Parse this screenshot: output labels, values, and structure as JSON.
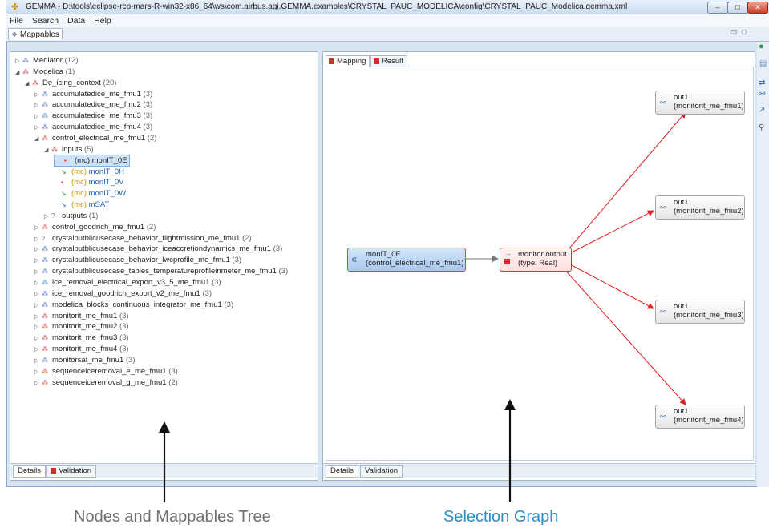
{
  "window": {
    "title": "GEMMA - D:\\tools\\eclipse-rcp-mars-R-win32-x86_64\\ws\\com.airbus.agi.GEMMA.examples\\CRYSTAL_PAUC_MODELICA\\config\\CRYSTAL_PAUC_Modelica.gemma.xml",
    "buttons": [
      "–",
      "□",
      "✕"
    ]
  },
  "menu": [
    "File",
    "Search",
    "Data",
    "Help"
  ],
  "view_tab": "Mappables",
  "tree": [
    {
      "label": "Mediator",
      "count": "(12)",
      "toggle": "▷",
      "icon": "mediator"
    },
    {
      "label": "Modelica",
      "count": "(1)",
      "toggle": "◢",
      "icon": "modelica"
    },
    {
      "label": "De_icing_context",
      "count": "(20)",
      "toggle": "◢",
      "icon": "context"
    },
    {
      "label": "accumulatedice_me_fmu1",
      "count": "(3)",
      "toggle": "▷",
      "icon": "node"
    },
    {
      "label": "accumulatedice_me_fmu2",
      "count": "(3)",
      "toggle": "▷",
      "icon": "node"
    },
    {
      "label": "accumulatedice_me_fmu3",
      "count": "(3)",
      "toggle": "▷",
      "icon": "node"
    },
    {
      "label": "accumulatedice_me_fmu4",
      "count": "(3)",
      "toggle": "▷",
      "icon": "node"
    },
    {
      "label": "control_electrical_me_fmu1",
      "count": "(2)",
      "toggle": "◢",
      "icon": "node-red"
    },
    {
      "label": "inputs",
      "count": "(5)",
      "toggle": "◢",
      "icon": "inputs"
    },
    {
      "prefix": "(mc)",
      "label": "monIT_0E",
      "count": "",
      "toggle": "",
      "icon": "input-red",
      "selected": true
    },
    {
      "prefix": "(mc)",
      "label": "monIT_0H",
      "count": "",
      "toggle": "",
      "icon": "input-green"
    },
    {
      "prefix": "(mc)",
      "label": "monIT_0V",
      "count": "",
      "toggle": "",
      "icon": "input-red"
    },
    {
      "prefix": "(mc)",
      "label": "monIT_0W",
      "count": "",
      "toggle": "",
      "icon": "input-green"
    },
    {
      "prefix": "(mc)",
      "label": "mSAT",
      "count": "",
      "toggle": "",
      "icon": "input-blue"
    },
    {
      "label": "outputs",
      "count": "(1)",
      "toggle": "▷",
      "icon": "outputs"
    },
    {
      "label": "control_goodrich_me_fmu1",
      "count": "(2)",
      "toggle": "▷",
      "icon": "node-red"
    },
    {
      "label": "crystalputblicusecase_behavior_flightmission_me_fmu1",
      "count": "(2)",
      "toggle": "▷",
      "icon": "node-q"
    },
    {
      "label": "crystalputblicusecase_behavior_iceaccretiondynamics_me_fmu1",
      "count": "(3)",
      "toggle": "▷",
      "icon": "node"
    },
    {
      "label": "crystalputblicusecase_behavior_lwcprofile_me_fmu1",
      "count": "(3)",
      "toggle": "▷",
      "icon": "node"
    },
    {
      "label": "crystalputblicusecase_tables_temperatureprofileinmeter_me_fmu1",
      "count": "(3)",
      "toggle": "▷",
      "icon": "node"
    },
    {
      "label": "ice_removal_electrical_export_v3_5_me_fmu1",
      "count": "(3)",
      "toggle": "▷",
      "icon": "node"
    },
    {
      "label": "ice_removal_goodrich_export_v2_me_fmu1",
      "count": "(3)",
      "toggle": "▷",
      "icon": "node"
    },
    {
      "label": "modelica_blocks_continuous_integrator_me_fmu1",
      "count": "(3)",
      "toggle": "▷",
      "icon": "node"
    },
    {
      "label": "monitorit_me_fmu1",
      "count": "(3)",
      "toggle": "▷",
      "icon": "node-red"
    },
    {
      "label": "monitorit_me_fmu2",
      "count": "(3)",
      "toggle": "▷",
      "icon": "node-red"
    },
    {
      "label": "monitorit_me_fmu3",
      "count": "(3)",
      "toggle": "▷",
      "icon": "node-red"
    },
    {
      "label": "monitorit_me_fmu4",
      "count": "(3)",
      "toggle": "▷",
      "icon": "node-red"
    },
    {
      "label": "monitorsat_me_fmu1",
      "count": "(3)",
      "toggle": "▷",
      "icon": "node"
    },
    {
      "label": "sequenceiceremoval_e_me_fmu1",
      "count": "(3)",
      "toggle": "▷",
      "icon": "node-red"
    },
    {
      "label": "sequenceiceremoval_g_me_fmu1",
      "count": "(2)",
      "toggle": "▷",
      "icon": "node-red"
    }
  ],
  "left_bottom_tabs": [
    "Details",
    "Validation"
  ],
  "graph_tabs": [
    "Mapping",
    "Result"
  ],
  "graph": {
    "source": {
      "line1": "monIT_0E",
      "line2": "(control_electrical_me_fmu1)"
    },
    "monitor": {
      "line1": "monitor output",
      "line2": "(type: Real)"
    },
    "outputs": [
      {
        "line1": "out1",
        "line2": "(monitorit_me_fmu1)"
      },
      {
        "line1": "out1",
        "line2": "(monitorit_me_fmu2)"
      },
      {
        "line1": "out1",
        "line2": "(monitorit_me_fmu3)"
      },
      {
        "line1": "out1",
        "line2": "(monitorit_me_fmu4)"
      }
    ]
  },
  "right_bottom_tabs": [
    "Details",
    "Validation"
  ],
  "captions": {
    "left": "Nodes and Mappables Tree",
    "right": "Selection Graph"
  },
  "colors": {
    "edge_red": "#e02020",
    "caption_blue": "#2a8fc8",
    "caption_gray": "#707070"
  }
}
